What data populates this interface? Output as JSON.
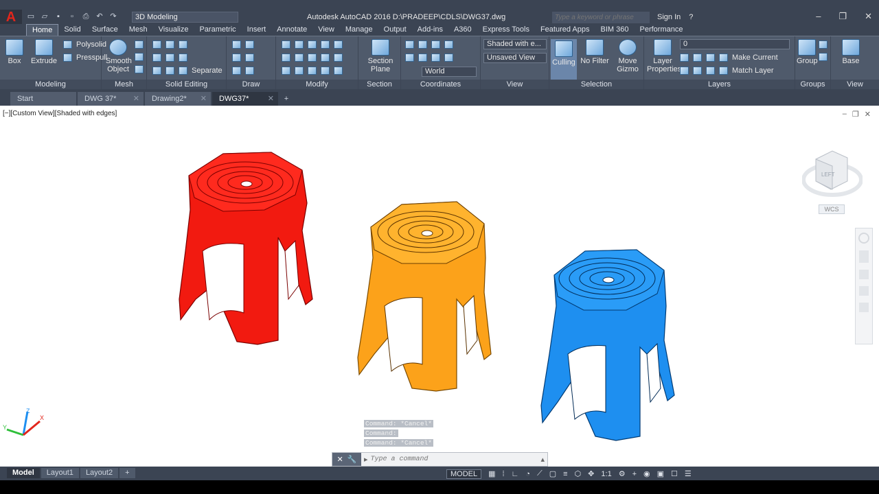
{
  "app": {
    "title": "Autodesk AutoCAD 2016    D:\\PRADEEP\\CDLS\\DWG37.dwg",
    "workspace": "3D Modeling",
    "search_placeholder": "Type a keyword or phrase",
    "signin": "Sign In"
  },
  "ribbon_tabs": [
    "Home",
    "Solid",
    "Surface",
    "Mesh",
    "Visualize",
    "Parametric",
    "Insert",
    "Annotate",
    "View",
    "Manage",
    "Output",
    "Add-ins",
    "A360",
    "Express Tools",
    "Featured Apps",
    "BIM 360",
    "Performance"
  ],
  "ribbon": {
    "modeling": {
      "title": "Modeling",
      "box": "Box",
      "extrude": "Extrude",
      "polysolid": "Polysolid",
      "presspull": "Presspull"
    },
    "mesh": {
      "title": "Mesh",
      "smooth": "Smooth Object"
    },
    "solid_editing": {
      "title": "Solid Editing",
      "separate": "Separate"
    },
    "draw": {
      "title": "Draw"
    },
    "modify": {
      "title": "Modify"
    },
    "section": {
      "title": "Section",
      "plane": "Section Plane"
    },
    "coordinates": {
      "title": "Coordinates",
      "world": "World"
    },
    "view": {
      "title": "View",
      "visual_style": "Shaded with e...",
      "saved_view": "Unsaved View"
    },
    "selection": {
      "title": "Selection",
      "culling": "Culling",
      "no_filter": "No Filter",
      "move_gizmo": "Move Gizmo"
    },
    "layers": {
      "title": "Layers",
      "layer_props": "Layer Properties",
      "current_layer": "0",
      "make_current": "Make Current",
      "match_layer": "Match Layer"
    },
    "groups": {
      "title": "Groups",
      "group": "Group"
    },
    "view2": {
      "title": "View",
      "base": "Base"
    }
  },
  "file_tabs": [
    {
      "label": "Start"
    },
    {
      "label": "DWG 37*"
    },
    {
      "label": "Drawing2*"
    },
    {
      "label": "DWG37*"
    }
  ],
  "viewport": {
    "label": "[−][Custom View][Shaded with edges]",
    "wcs": "WCS",
    "colors": {
      "red": "#f21a10",
      "orange": "#fca21a",
      "blue": "#1e8ff0"
    }
  },
  "command": {
    "history": [
      "Command: *Cancel*",
      "Command:",
      "Command: *Cancel*"
    ],
    "placeholder": "Type a command"
  },
  "status": {
    "layout_tabs": [
      "Model",
      "Layout1",
      "Layout2"
    ],
    "model": "MODEL",
    "scale": "1:1"
  }
}
